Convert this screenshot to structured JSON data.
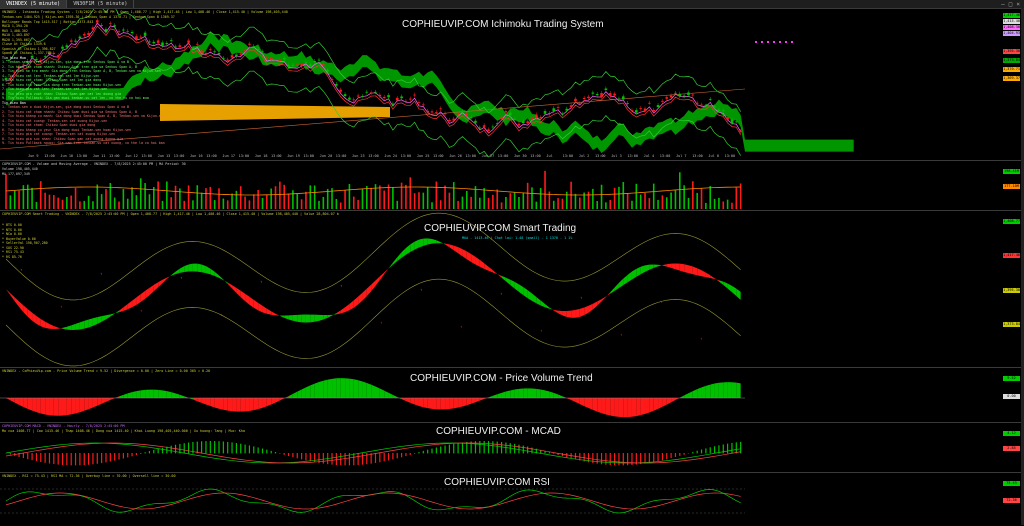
{
  "window": {
    "tabs": [
      "VNINDEX (5 minute)",
      "VN30F1M (5 minute)"
    ]
  },
  "panes": [
    {
      "id": "ichimoku",
      "title": "COPHIEUVIP.COM Ichimoku Trading System",
      "header": "VNINDEX - Ichimoku Trading System - 7/8/2025 2:45:00 PM | Open 1,408.77 | High 1,417.46 | Low 1,408.46 | Close 1,415.40 | Volume 198,405,440",
      "info_lines": [
        "Tenkan-sen 1404.925 | Kijun-sen 1395.30 | Senkou Span A 1370.71 | Senkou Span B 1369.37",
        "Bollinger Bands Top 1415.517 | Bottom 1373.843",
        "MACD 1,394.20",
        "MA5 1,408.302",
        "MA10 1,403.897",
        "MA20 1,395.667",
        "Close At Chikou 1339.6",
        "Spanish At Chikou 1,396.827",
        "SpanB At Chikou 1,337.766",
        "Tin hieu Mua",
        "1. Tenkan-sen o tren Kijun-sen, gia dong tren Senkou Span A va B",
        "2. Tin hieu cat chom nhanh: Chikou Span tren gia va Senkou Span A, B",
        "3. Tin hieu ho tro manh: Gia dong tren Senkou Span A, B, Tenkan-sen va Kijun-sen",
        "4. Tin hieu cat len: Tenkan-sen cat len Kijun-sen",
        "5. Tin hieu cat chom: Chikou Span cat len gia dong",
        "6. Tin hieu tro len: Gia dong tren Tenkan-sen hoac Kijun-sen",
        "7. Tin hieu gia cat len: Tenkan-sen cat len Kijun-sen",
        "8. Tin hieu gia vuot nhan: Chikou Span gan cat len duong gia",
        "9. Tin hieu Pullback: Gia gan duoi tenkan-su cat len, co the tu co hoi mua",
        "Tin hieu Ban",
        "1. Tenkan-sen o duoi Kijun-sen, gia dong duoi Senkou Span A va B",
        "2. Tin hieu cat chom nhanh: Chikou Span duoi gia va Senkou Span A, B",
        "3. Tin hieu khang cu manh: Gia dong duoi Senkou Span A, B, Tenkan-sen va Kijun-sen",
        "4. Tin hieu cat xuong: Tenkan-sen cat xuong Kijun-sen",
        "5. Tin hieu cat chom: Chikou Span duoi gia dong",
        "6. Tin hieu khang cu yeu: Gia dong duoi Tenkan-sen hoac Kijun-sen",
        "7. Tin hieu gia cat xuong: Tenkan-sen cat xuong Kijun-sen",
        "8. Tin hieu gia suc nhan: Chikou Span gan cat xuong duong gia",
        "9. Tin hieu Pullback nguoc: Gia nam tren tenkan-su cat xuong, co the la co hoi ban"
      ],
      "axis_labels": [
        {
          "text": "1,417.46",
          "color": "#00cc00"
        },
        {
          "text": "1,415.40",
          "color": "#dddddd"
        },
        {
          "text": "1,408.30",
          "color": "#ff66ff"
        },
        {
          "text": "1,404.93",
          "color": "#cc99ff"
        },
        {
          "text": "1,395.30",
          "color": "#ff4444"
        },
        {
          "text": "1,373.84",
          "color": "#00aa00"
        },
        {
          "text": "1,370.71",
          "color": "#ffaa00"
        },
        {
          "text": "1,369.37",
          "color": "#ffaa00"
        }
      ]
    },
    {
      "id": "volume",
      "header": "COPHIEUVIP.COM - Volume and Moving Average - VNINDEX - 7/8/2025 2:45:00 PM | MA Period: 30",
      "info_lines": [
        "Volume 198,405,440",
        "MA 177,097,349"
      ],
      "axis_labels": [
        {
          "text": "198.41M",
          "color": "#00cc00"
        },
        {
          "text": "177.10M",
          "color": "#ff8800"
        }
      ]
    },
    {
      "id": "smart",
      "title": "COPHIEUVIP.COM Smart Trading",
      "subtitle": "MUA - 1413.46 | Chot lai: 1.40 (small) - 1 1370 - 1 1%",
      "header": "COPHIEUVIP.COM Smart Trading - VNINDEX - 7/8/2025 2:45:00 PM | Open 1,408.77 | High 1,417.46 | Low 1,408.46 | Close 1,415.40 | Volume 198,405,440 | Value 28,804.07 b",
      "info_lines": [
        "* BTS 0.00",
        "* NTS 0.00",
        "* NCa 0.00",
        "* BuyerValue 0.00",
        "* SellerVal 198,907,280",
        "* SUS 22.90",
        "* RS1 75.43",
        "* RS 85.76"
      ],
      "axis_labels": [
        {
          "text": "1,408.77",
          "color": "#00cc00"
        },
        {
          "text": "1,417.46",
          "color": "#ff3333"
        },
        {
          "text": "1,395.30",
          "color": "#cccc00"
        },
        {
          "text": "1,373.84",
          "color": "#cccc00"
        }
      ]
    },
    {
      "id": "pvt",
      "title": "COPHIEUVIP.COM - Price Volume Trend",
      "header": "VNINDEX - CoPhieuVip.com - Price Volume Trend = 9.52 | Divergence = 0.00 | Zero Line = 0.00 365 = 0.26",
      "axis_labels": [
        {
          "text": "9.52",
          "color": "#00cc00"
        },
        {
          "text": "0.00",
          "color": "#dddddd"
        }
      ]
    },
    {
      "id": "macd",
      "title": "COPHIEUVIP.COM - MCAD",
      "header": "COPHIEUVIP.COM MACD - VNINDEX - Hourly - 7/8/2025 2:45:00 PM",
      "header2": "Mo cua 1408.77 | Cao 1415.46 | Thap 1408.46 | Dong cua 1415.40 | Khoi Luong 198,405,440.000 | Xu huong: Tang | Muc: Kha",
      "axis_labels": [
        {
          "text": "4.12",
          "color": "#00cc00"
        },
        {
          "text": "2.85",
          "color": "#ff4444"
        }
      ]
    },
    {
      "id": "rsi",
      "title": "COPHIEUVIP.COM RSI",
      "header": "VNINDEX - RSI = 75.43 | RSI MA = 72.36 | Overbuy line = 70.00 | Oversell line = 30.00",
      "axis_labels": [
        {
          "text": "75.43",
          "color": "#00cc00"
        },
        {
          "text": "72.36",
          "color": "#ff4444"
        }
      ]
    }
  ],
  "date_axis": [
    "Jun 9",
    "13:00",
    "Jun 10",
    "13:00",
    "Jun 11",
    "13:00",
    "Jun 12",
    "13:00",
    "Jun 13",
    "13:00",
    "Jun 16",
    "13:00",
    "Jun 17",
    "13:00",
    "Jun 18",
    "13:00",
    "Jun 19",
    "13:00",
    "Jun 20",
    "13:00",
    "Jun 23",
    "13:00",
    "Jun 24",
    "13:00",
    "Jun 25",
    "13:00",
    "Jun 26",
    "13:00",
    "Jun 27",
    "13:00",
    "Jun 30",
    "13:00",
    "Jul",
    "13:00",
    "Jul 2",
    "13:00",
    "Jul 3",
    "13:00",
    "Jul 4",
    "13:00",
    "Jul 7",
    "13:00",
    "Jul 8",
    "13:00"
  ],
  "colors": {
    "up": "#00c000",
    "down": "#ff1a1a",
    "cloud_up": "#00b000",
    "cloud_down": "#ffb300",
    "text": "#dddddd"
  }
}
